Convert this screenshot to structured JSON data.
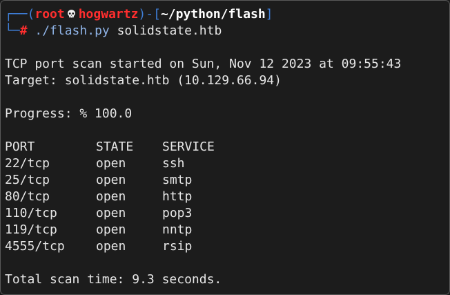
{
  "prompt": {
    "frame_top_left": "┌──(",
    "user": "root",
    "skull_icon": "skull-icon",
    "host": "hogwartz",
    "separator": ")-[",
    "path": "~/python/flash",
    "frame_top_right": "]",
    "frame_bottom": "└─",
    "symbol": "#",
    "command_script": "./flash.py",
    "command_arg": "solidstate.htb"
  },
  "output": {
    "scan_started": "TCP port scan started on Sun, Nov 12 2023 at 09:55:43",
    "target": "Target: solidstate.htb (10.129.66.94)",
    "progress": "Progress: % 100.0",
    "table": {
      "headers": {
        "port": "PORT",
        "state": "STATE",
        "service": "SERVICE"
      },
      "rows": [
        {
          "port": "22/tcp",
          "state": "open",
          "service": "ssh"
        },
        {
          "port": "25/tcp",
          "state": "open",
          "service": "smtp"
        },
        {
          "port": "80/tcp",
          "state": "open",
          "service": "http"
        },
        {
          "port": "110/tcp",
          "state": "open",
          "service": "pop3"
        },
        {
          "port": "119/tcp",
          "state": "open",
          "service": "nntp"
        },
        {
          "port": "4555/tcp",
          "state": "open",
          "service": "rsip"
        }
      ]
    },
    "total_time": "Total scan time: 9.3 seconds."
  },
  "colors": {
    "background": "#1c1c1c",
    "frame": "#3f7fd8",
    "user_host": "#ff2e2e",
    "text": "#e6e6e6"
  }
}
